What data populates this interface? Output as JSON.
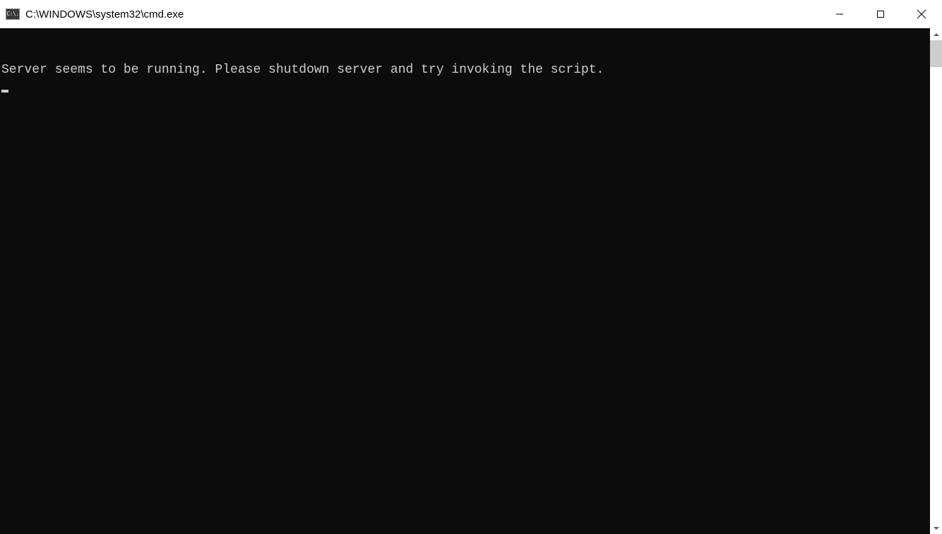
{
  "window": {
    "title": "C:\\WINDOWS\\system32\\cmd.exe",
    "icon_label": "C:\\."
  },
  "terminal": {
    "lines": [
      "Server seems to be running. Please shutdown server and try invoking the script."
    ]
  }
}
